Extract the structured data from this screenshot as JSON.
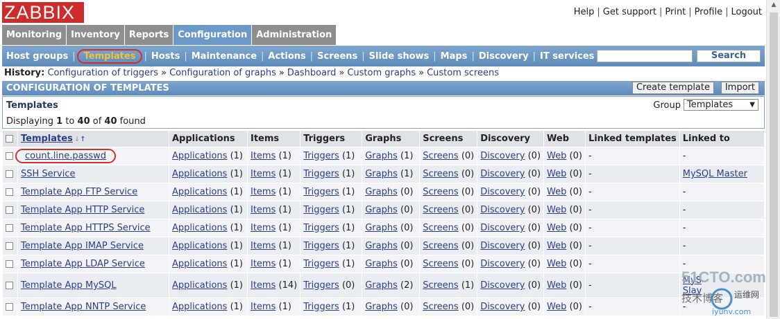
{
  "logo": "ZABBIX",
  "top_links": [
    "Help",
    "Get support",
    "Print",
    "Profile",
    "Logout"
  ],
  "main_tabs": [
    "Monitoring",
    "Inventory",
    "Reports",
    "Configuration",
    "Administration"
  ],
  "sub_nav": [
    "Host groups",
    "Templates",
    "Hosts",
    "Maintenance",
    "Actions",
    "Screens",
    "Slide shows",
    "Maps",
    "Discovery",
    "IT services"
  ],
  "search": {
    "button": "Search",
    "value": ""
  },
  "history": {
    "label": "History:",
    "items": [
      "Configuration of triggers",
      "Configuration of graphs",
      "Dashboard",
      "Custom graphs",
      "Custom screens"
    ]
  },
  "config": {
    "title": "CONFIGURATION OF TEMPLATES",
    "create_button": "Create template",
    "import_button": "Import"
  },
  "templates_box": {
    "title": "Templates",
    "display_prefix": "Displaying ",
    "from": "1",
    "to_word": " to ",
    "to": "40",
    "of_word": " of ",
    "total": "40",
    "found_word": " found",
    "group_label": "Group",
    "group_value": "Templates"
  },
  "table": {
    "headers": [
      "Templates",
      "Applications",
      "Items",
      "Triggers",
      "Graphs",
      "Screens",
      "Discovery",
      "Web",
      "Linked templates",
      "Linked to"
    ],
    "rows": [
      {
        "name": "count.line.passwd",
        "apps": "(1)",
        "items": "(1)",
        "triggers": "(1)",
        "graphs": "(1)",
        "screens": "(0)",
        "discovery": "(0)",
        "web": "(0)",
        "linked_templates": "-",
        "linked_to": "-"
      },
      {
        "name": "SSH Service",
        "apps": "(1)",
        "items": "(1)",
        "triggers": "(1)",
        "graphs": "(1)",
        "screens": "(0)",
        "discovery": "(0)",
        "web": "(0)",
        "linked_templates": "-",
        "linked_to": "MySQL Master"
      },
      {
        "name": "Template App FTP Service",
        "apps": "(1)",
        "items": "(1)",
        "triggers": "(1)",
        "graphs": "(0)",
        "screens": "(0)",
        "discovery": "(0)",
        "web": "(0)",
        "linked_templates": "-",
        "linked_to": "-"
      },
      {
        "name": "Template App HTTP Service",
        "apps": "(1)",
        "items": "(1)",
        "triggers": "(1)",
        "graphs": "(0)",
        "screens": "(0)",
        "discovery": "(0)",
        "web": "(0)",
        "linked_templates": "-",
        "linked_to": "-"
      },
      {
        "name": "Template App HTTPS Service",
        "apps": "(1)",
        "items": "(1)",
        "triggers": "(1)",
        "graphs": "(0)",
        "screens": "(0)",
        "discovery": "(0)",
        "web": "(0)",
        "linked_templates": "-",
        "linked_to": "-"
      },
      {
        "name": "Template App IMAP Service",
        "apps": "(1)",
        "items": "(1)",
        "triggers": "(1)",
        "graphs": "(0)",
        "screens": "(0)",
        "discovery": "(0)",
        "web": "(0)",
        "linked_templates": "-",
        "linked_to": "-"
      },
      {
        "name": "Template App LDAP Service",
        "apps": "(1)",
        "items": "(1)",
        "triggers": "(1)",
        "graphs": "(0)",
        "screens": "(0)",
        "discovery": "(0)",
        "web": "(0)",
        "linked_templates": "-",
        "linked_to": "-"
      },
      {
        "name": "Template App MySQL",
        "apps": "(1)",
        "items": "(14)",
        "triggers": "(0)",
        "graphs": "(2)",
        "screens": "(1)",
        "discovery": "(0)",
        "web": "(0)",
        "linked_templates": "-",
        "linked_to": "MyS",
        "linked_to_2": "Slav"
      },
      {
        "name": "Template App NNTP Service",
        "apps": "(1)",
        "items": "(1)",
        "triggers": "(1)",
        "graphs": "(0)",
        "screens": "(0)",
        "discovery": "(0)",
        "web": "(0)",
        "linked_templates": "-",
        "linked_to": "-"
      }
    ],
    "link_labels": {
      "apps": "Applications",
      "items": "Items",
      "triggers": "Triggers",
      "graphs": "Graphs",
      "screens": "Screens",
      "discovery": "Discovery",
      "web": "Web"
    }
  },
  "watermark": {
    "brand": "51CTO.com",
    "line2": "技术博客",
    "line3": "运维网",
    "line4": "iyunv.com"
  },
  "colors": {
    "logo": "#d02b2b",
    "nav": "#6c99c9",
    "highlight": "#d42d2d"
  }
}
